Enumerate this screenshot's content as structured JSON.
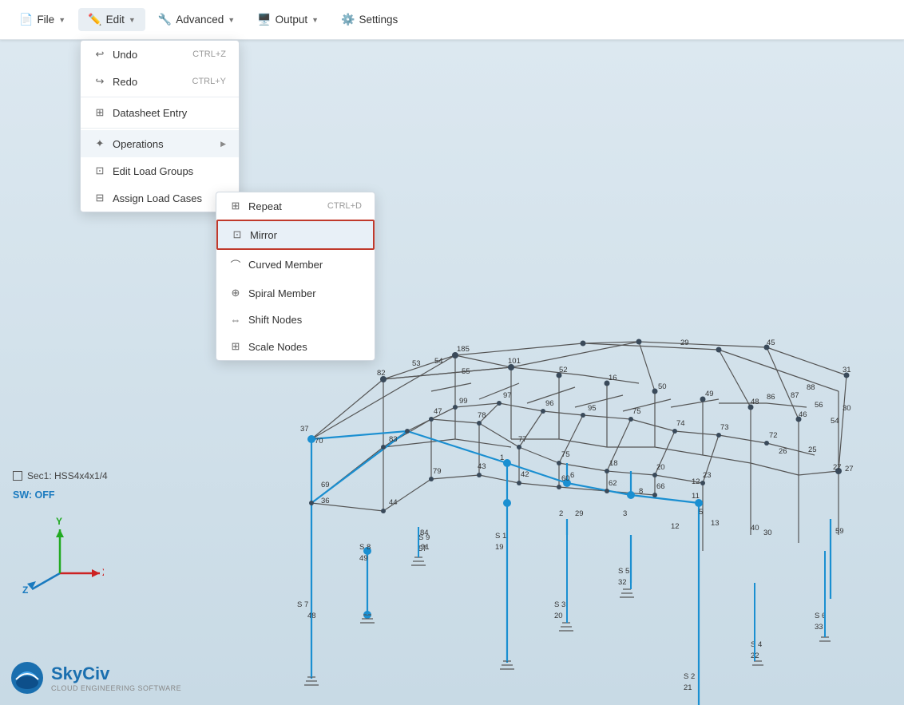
{
  "menubar": {
    "file_label": "File",
    "edit_label": "Edit",
    "advanced_label": "Advanced",
    "output_label": "Output",
    "settings_label": "Settings"
  },
  "edit_menu": {
    "undo_label": "Undo",
    "undo_shortcut": "CTRL+Z",
    "redo_label": "Redo",
    "redo_shortcut": "CTRL+Y",
    "datasheet_label": "Datasheet Entry",
    "operations_label": "Operations",
    "edit_load_groups_label": "Edit Load Groups",
    "assign_load_cases_label": "Assign Load Cases"
  },
  "operations_submenu": {
    "repeat_label": "Repeat",
    "repeat_shortcut": "CTRL+D",
    "mirror_label": "Mirror",
    "curved_member_label": "Curved Member",
    "spiral_member_label": "Spiral Member",
    "shift_nodes_label": "Shift Nodes",
    "scale_nodes_label": "Scale Nodes"
  },
  "status": {
    "section_label": "Sec1: HSS4x4x1/4",
    "sw_label": "SW: OFF"
  },
  "logo": {
    "brand": "SkyCiv",
    "tagline": "CLOUD ENGINEERING SOFTWARE"
  },
  "axes": {
    "x_label": "X",
    "y_label": "Y",
    "z_label": "Z"
  }
}
